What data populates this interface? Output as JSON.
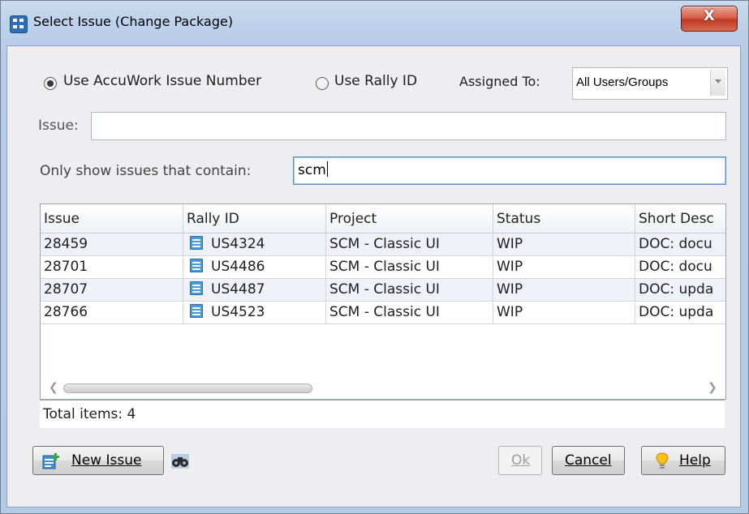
{
  "window": {
    "title": "Select Issue (Change Package)",
    "close_label": "X"
  },
  "filters": {
    "radio_accuwork_label": "Use AccuWork Issue Number",
    "radio_rally_label": "Use Rally ID",
    "radio_selected": "accuwork",
    "assigned_to_label": "Assigned To:",
    "assigned_to_value": "All Users/Groups",
    "issue_label": "Issue:",
    "issue_value": "",
    "contain_label": "Only show issues that contain:",
    "contain_value": "scm"
  },
  "table": {
    "columns": [
      "Issue",
      "Rally ID",
      "Project",
      "Status",
      "Short Desc"
    ],
    "rows": [
      {
        "issue": "28459",
        "rally": "US4324",
        "project": "SCM - Classic UI",
        "status": "WIP",
        "desc": "DOC: docu"
      },
      {
        "issue": "28701",
        "rally": "US4486",
        "project": "SCM - Classic UI",
        "status": "WIP",
        "desc": "DOC: docu"
      },
      {
        "issue": "28707",
        "rally": "US4487",
        "project": "SCM - Classic UI",
        "status": "WIP",
        "desc": "DOC: upda"
      },
      {
        "issue": "28766",
        "rally": "US4523",
        "project": "SCM - Classic UI",
        "status": "WIP",
        "desc": "DOC: upda"
      }
    ],
    "total_label": "Total items: 4"
  },
  "buttons": {
    "new_issue_label": "New Issue",
    "ok_label": "Ok",
    "cancel_label": "Cancel",
    "help_label": "Help"
  },
  "icons": {
    "app": "dialog-app-icon",
    "story": "user-story-icon",
    "new_issue": "new-issue-icon",
    "find": "binoculars-icon",
    "help": "help-bulb-icon"
  }
}
